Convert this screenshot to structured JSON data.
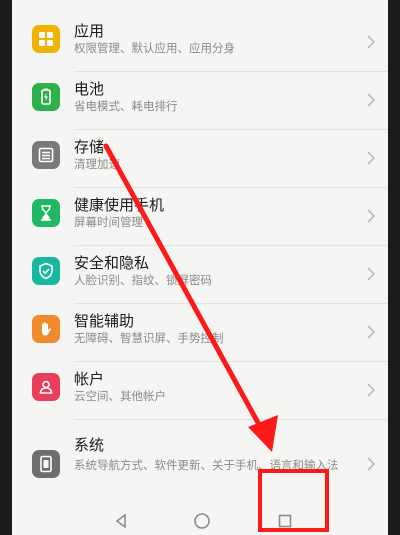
{
  "settings": {
    "items": [
      {
        "title": "应用",
        "subtitle": "权限管理、默认应用、应用分身",
        "icon": "apps-icon",
        "color": "#f0b400"
      },
      {
        "title": "电池",
        "subtitle": "省电模式、耗电排行",
        "icon": "battery-icon",
        "color": "#2fb04a"
      },
      {
        "title": "存储",
        "subtitle": "清理加速",
        "icon": "storage-icon",
        "color": "#7a7a7a"
      },
      {
        "title": "健康使用手机",
        "subtitle": "屏幕时间管理",
        "icon": "hourglass-icon",
        "color": "#20b864"
      },
      {
        "title": "安全和隐私",
        "subtitle": "人脸识别、指纹、锁屏密码",
        "icon": "shield-icon",
        "color": "#18b8a0"
      },
      {
        "title": "智能辅助",
        "subtitle": "无障碍、智慧识屏、手势控制",
        "icon": "hand-icon",
        "color": "#f08a2c"
      },
      {
        "title": "帐户",
        "subtitle": "云空间、其他帐户",
        "icon": "account-icon",
        "color": "#e8405a"
      },
      {
        "title": "系统",
        "subtitle": "系统导航方式、软件更新、关于手机、语言和输入法",
        "icon": "system-icon",
        "color": "#6e6e6e"
      }
    ]
  },
  "navigation": {
    "back": "back-icon",
    "home": "home-icon",
    "recents": "recents-icon"
  },
  "annotation": {
    "arrow_color": "#ff1a1a",
    "highlight_color": "#ff1a1a"
  }
}
